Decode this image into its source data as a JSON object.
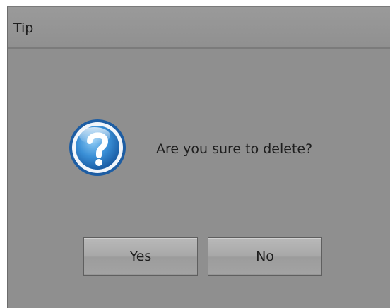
{
  "dialog": {
    "title": "Tip",
    "message": "Are you sure to delete?",
    "icon": "question-icon",
    "buttons": {
      "yes_label": "Yes",
      "no_label": "No"
    }
  }
}
